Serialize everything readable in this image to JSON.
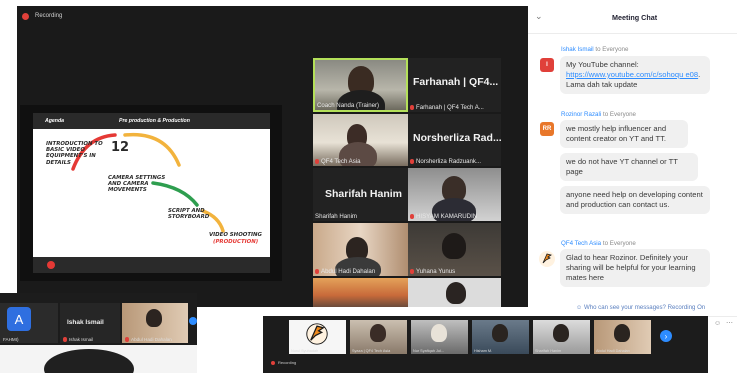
{
  "meeting": {
    "recording_label": "Recording"
  },
  "slide": {
    "title_left": "Agenda",
    "title_center": "Pre production & Production",
    "item1": "Introduction to basic video equipment's in details",
    "item1_badge": "12",
    "item2": "Camera settings and camera movements",
    "item3": "Script and storyboard",
    "item4_line1": "Video shooting",
    "item4_line2": "(Production)"
  },
  "tiles": [
    {
      "label": "Coach Nanda (Trainer)",
      "big": ""
    },
    {
      "label": "Farhanah | QF4 Tech A...",
      "big": "Farhanah  |  QF4..."
    },
    {
      "label": "QF4 Tech Asia",
      "big": ""
    },
    {
      "label": "Norsherliza Radzuank...",
      "big": "Norsherliza  Rad..."
    },
    {
      "label": "Sharifah Hanim",
      "big": "Sharifah Hanim"
    },
    {
      "label": "HISYAM KAMARUDIN",
      "big": ""
    },
    {
      "label": "Abdul Hadi Dahalan",
      "big": ""
    },
    {
      "label": "Yuhana Yunus",
      "big": ""
    }
  ],
  "chat": {
    "title": "Meeting Chat",
    "messages": [
      {
        "sender": "Ishak Ismail",
        "to": "to Everyone",
        "avatar": "I",
        "avatar_color": "#e0403a",
        "text_prefix": "My YouTube channel:",
        "link": "https://www.youtube.com/c/sohoqu e08",
        "text_suffix": ". Lama dah tak update"
      },
      {
        "sender": "Rozinor Razali",
        "to": "to Everyone",
        "avatar": "RR",
        "avatar_color": "#e8772a",
        "bubble1": "we mostly help influencer and content creator on YT and TT.",
        "bubble2": "we do not have YT channel or TT page",
        "bubble3": "anyone need help on developing content and production can contact us."
      },
      {
        "sender": "QF4 Tech Asia",
        "to": "to Everyone",
        "text": "Glad to hear Rozinor. Definitely your sharing will be helpful for your learning mates here"
      }
    ],
    "footer": "Who can see your messages? Recording On"
  },
  "small_window": {
    "avatar_letter": "A",
    "avatar_color": "#2f6fe0",
    "name_big": "Ishak Ismail",
    "label1": "Ishak Ismail",
    "label2": "Abdul Hadi Dahalan",
    "label_left": "FAHMI)"
  },
  "strip": {
    "labels": [
      "Nurul Syuhadah",
      "Syaza | QF4 Tech Asia",
      "Nur Syafiqah Jul...",
      "Hisham M.",
      "Sharifah Hanim",
      "Abdul Hadi Dahalan"
    ],
    "recording_label": "Recording"
  }
}
